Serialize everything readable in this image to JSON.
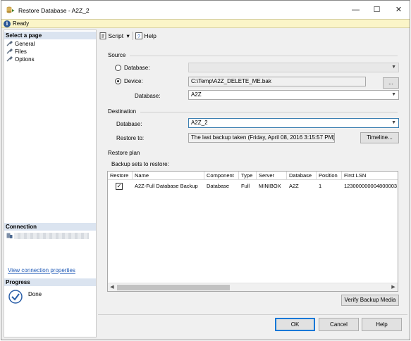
{
  "window": {
    "title": "Restore Database - A2Z_2",
    "minimize": "—",
    "maximize": "☐",
    "close": "✕"
  },
  "status": {
    "text": "Ready",
    "icon": "info-icon"
  },
  "left": {
    "select_page": "Select a page",
    "pages": [
      "General",
      "Files",
      "Options"
    ],
    "connection": "Connection",
    "view_connection": "View connection properties",
    "progress": "Progress",
    "progress_status": "Done"
  },
  "toolbar": {
    "script": "Script",
    "script_arrow": "▾",
    "help": "Help"
  },
  "source": {
    "section": "Source",
    "database_label": "Database:",
    "device_label": "Device:",
    "device_value": "C:\\Temp\\A2Z_DELETE_ME.bak",
    "browse": "...",
    "db_label": "Database:",
    "db_value": "A2Z"
  },
  "destination": {
    "section": "Destination",
    "database_label": "Database:",
    "database_value": "A2Z_2",
    "restore_to_label": "Restore to:",
    "restore_to_value": "The last backup taken (Friday, April 08, 2016 3:15:57 PM)",
    "timeline": "Timeline..."
  },
  "restore_plan": {
    "section": "Restore plan",
    "backup_sets_label": "Backup sets to restore:",
    "columns": [
      "Restore",
      "Name",
      "Component",
      "Type",
      "Server",
      "Database",
      "Position",
      "First LSN"
    ],
    "rows": [
      {
        "restore": "✓",
        "name": "A2Z-Full Database Backup",
        "component": "Database",
        "type": "Full",
        "server": "MINIBOX",
        "database": "A2Z",
        "position": "1",
        "first_lsn": "123000000004800003"
      }
    ],
    "verify": "Verify Backup Media"
  },
  "buttons": {
    "ok": "OK",
    "cancel": "Cancel",
    "help": "Help"
  },
  "colors": {
    "accent": "#0078d7",
    "status_bg": "#fbf5c8",
    "header_bg": "#dbe4f0",
    "link": "#1a56b5"
  }
}
